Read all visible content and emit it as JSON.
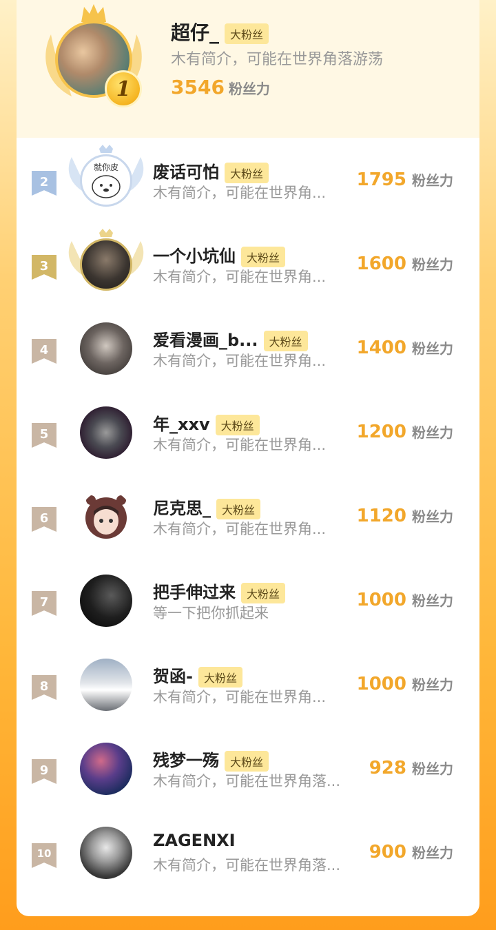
{
  "top": {
    "rank": "1",
    "name": "超仔_",
    "badge": "大粉丝",
    "bio": "木有简介，可能在世界角落游荡",
    "power": "3546",
    "power_label": "粉丝力"
  },
  "rows": [
    {
      "rank": "2",
      "name": "废话可怕",
      "badge": "大粉丝",
      "bio": "木有简介，可能在世界角...",
      "power": "1795",
      "power_label": "粉丝力",
      "avatar_text": "就你皮"
    },
    {
      "rank": "3",
      "name": "一个小坑仙",
      "badge": "大粉丝",
      "bio": "木有简介，可能在世界角...",
      "power": "1600",
      "power_label": "粉丝力"
    },
    {
      "rank": "4",
      "name": "爱看漫画_b...",
      "badge": "大粉丝",
      "bio": "木有简介，可能在世界角...",
      "power": "1400",
      "power_label": "粉丝力"
    },
    {
      "rank": "5",
      "name": "年_xxv",
      "badge": "大粉丝",
      "bio": "木有简介，可能在世界角...",
      "power": "1200",
      "power_label": "粉丝力"
    },
    {
      "rank": "6",
      "name": "尼克思_",
      "badge": "大粉丝",
      "bio": "木有简介，可能在世界角...",
      "power": "1120",
      "power_label": "粉丝力"
    },
    {
      "rank": "7",
      "name": "把手伸过来",
      "badge": "大粉丝",
      "bio": "等一下把你抓起来",
      "power": "1000",
      "power_label": "粉丝力"
    },
    {
      "rank": "8",
      "name": "贺函-",
      "badge": "大粉丝",
      "bio": "木有简介，可能在世界角...",
      "power": "1000",
      "power_label": "粉丝力"
    },
    {
      "rank": "9",
      "name": "残梦一殇",
      "badge": "大粉丝",
      "bio": "木有简介，可能在世界角落...",
      "power": "928",
      "power_label": "粉丝力"
    },
    {
      "rank": "10",
      "name": "ZAGENXI",
      "badge": "",
      "bio": "木有简介，可能在世界角落...",
      "power": "900",
      "power_label": "粉丝力"
    }
  ],
  "colors": {
    "accent": "#f2a72b",
    "badge_bg": "#fde79a",
    "rank2": "#a8c1e2",
    "rank3": "#d2b766",
    "rank_other": "#c9b6a4"
  }
}
